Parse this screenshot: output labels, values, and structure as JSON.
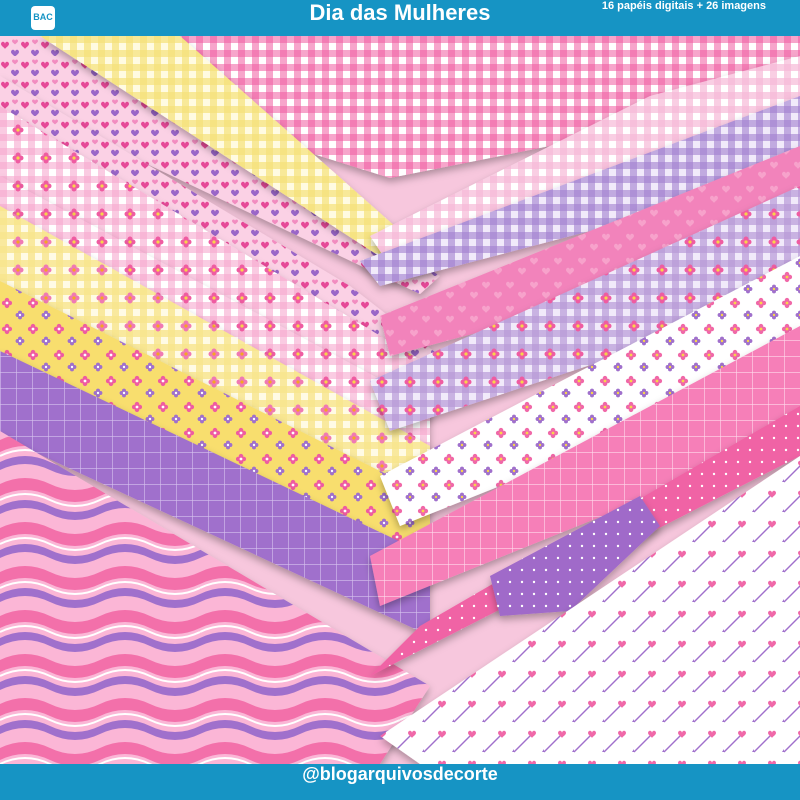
{
  "header": {
    "logo_text": "BAC",
    "title": "Dia das Mulheres",
    "subtitle": "16 papéis digitais + 26 imagens"
  },
  "footer": {
    "handle": "@blogarquivosdecorte"
  },
  "papers": [
    {
      "pattern": "gingham",
      "color": "#f05aa0"
    },
    {
      "pattern": "hearts-multi",
      "color": "#e86bb0"
    },
    {
      "pattern": "gingham",
      "color": "#f5e27a"
    },
    {
      "pattern": "gingham-flowers",
      "color": "#f6a8cf"
    },
    {
      "pattern": "gingham-flowers",
      "color": "#f6a8cf"
    },
    {
      "pattern": "gingham-flowers",
      "color": "#f7e58c"
    },
    {
      "pattern": "flowers",
      "color": "#f8de6e"
    },
    {
      "pattern": "grid",
      "color": "#a070cc"
    },
    {
      "pattern": "waves",
      "color": "#f36faa"
    },
    {
      "pattern": "gingham",
      "color": "#f7b9d8"
    },
    {
      "pattern": "gingham",
      "color": "#b89ad8"
    },
    {
      "pattern": "hearts",
      "color": "#f283bb"
    },
    {
      "pattern": "gingham-flowers",
      "color": "#b89ad8"
    },
    {
      "pattern": "flowers",
      "color": "#ffffff"
    },
    {
      "pattern": "grid",
      "color": "#f67fb8"
    },
    {
      "pattern": "dots",
      "color": "#f063a5"
    },
    {
      "pattern": "dots",
      "color": "#a06ac9"
    },
    {
      "pattern": "hearts-arrows",
      "color": "#ffffff"
    }
  ]
}
